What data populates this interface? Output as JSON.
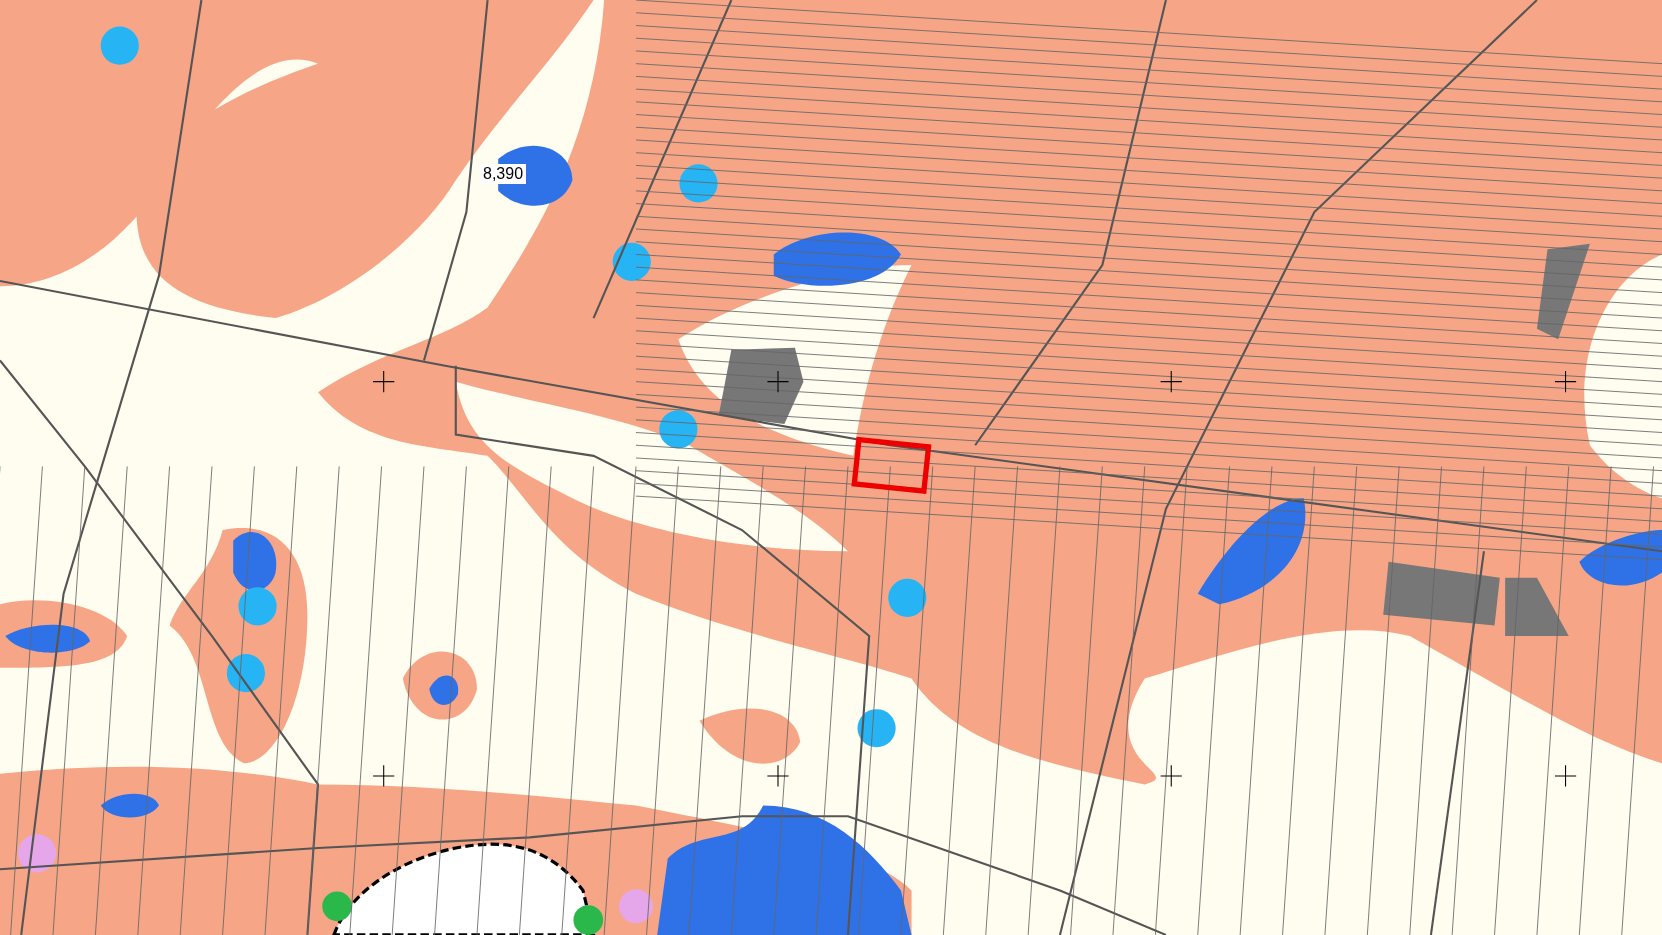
{
  "map": {
    "label": "8,390"
  }
}
